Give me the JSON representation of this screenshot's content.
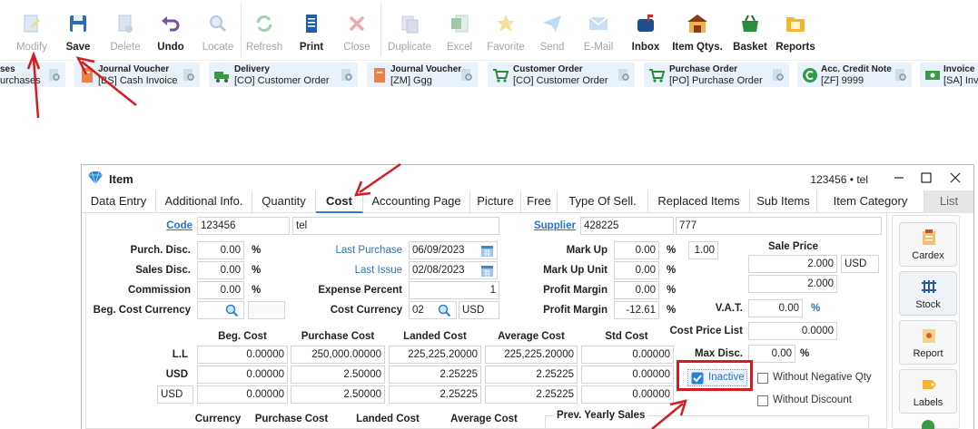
{
  "toolbar": {
    "buttons": [
      {
        "label": "Modify",
        "icon": "edit-doc-icon",
        "enabled": false
      },
      {
        "label": "Save",
        "icon": "floppy-disk-icon",
        "enabled": true
      },
      {
        "label": "Delete",
        "icon": "delete-doc-icon",
        "enabled": false
      },
      {
        "label": "Undo",
        "icon": "undo-arrow-icon",
        "enabled": true
      },
      {
        "label": "Locate",
        "icon": "magnifier-icon",
        "enabled": false
      },
      {
        "label": "Refresh",
        "icon": "refresh-icon",
        "enabled": false
      },
      {
        "label": "Print",
        "icon": "printer-icon",
        "enabled": true
      },
      {
        "label": "Close",
        "icon": "close-x-icon",
        "enabled": false
      },
      {
        "label": "Duplicate",
        "icon": "duplicate-icon",
        "enabled": false
      },
      {
        "label": "Excel",
        "icon": "excel-icon",
        "enabled": false
      },
      {
        "label": "Favorite",
        "icon": "star-icon",
        "enabled": false
      },
      {
        "label": "Send",
        "icon": "paper-plane-icon",
        "enabled": false
      },
      {
        "label": "E-Mail",
        "icon": "envelope-icon",
        "enabled": false
      },
      {
        "label": "Inbox",
        "icon": "mailbox-icon",
        "enabled": true
      },
      {
        "label": "Item Qtys.",
        "icon": "warehouse-icon",
        "enabled": true
      },
      {
        "label": "Basket",
        "icon": "basket-icon",
        "enabled": true
      },
      {
        "label": "Reports",
        "icon": "reports-folder-icon",
        "enabled": true
      }
    ]
  },
  "quickbar": {
    "items": [
      {
        "title": "ses",
        "subtitle": "urchases",
        "icon": "doc-icon"
      },
      {
        "title": "Journal Voucher",
        "subtitle": "[BS] Cash Invoice",
        "icon": "journal-icon"
      },
      {
        "title": "Delivery",
        "subtitle": "[CO] Customer Order",
        "icon": "truck-icon"
      },
      {
        "title": "Journal Voucher",
        "subtitle": "[ZM] Ggg",
        "icon": "journal-icon"
      },
      {
        "title": "Customer Order",
        "subtitle": "[CO] Customer Order",
        "icon": "cart-icon"
      },
      {
        "title": "Purchase Order",
        "subtitle": "[PO] Purchase Order",
        "icon": "cart-icon"
      },
      {
        "title": "Acc. Credit Note",
        "subtitle": "[ZF] 9999",
        "icon": "credit-note-icon"
      },
      {
        "title": "Invoice",
        "subtitle": "[SA] Invoice",
        "icon": "invoice-icon"
      }
    ]
  },
  "window": {
    "title": "Item",
    "meta": "123456 • tel",
    "tabs": [
      "Data Entry",
      "Additional Info.",
      "Quantity",
      "Cost",
      "Accounting Page",
      "Picture",
      "Free",
      "Type Of Sell.",
      "Replaced Items",
      "Sub Items",
      "Item Category",
      "List"
    ],
    "selected_tab": "Cost"
  },
  "form": {
    "code_label": "Code",
    "code_value": "123456",
    "name_value": "tel",
    "supplier_label": "Supplier",
    "supplier_code": "428225",
    "supplier_name": "777",
    "purch_disc_label": "Purch. Disc.",
    "purch_disc": "0.00",
    "sales_disc_label": "Sales Disc.",
    "sales_disc": "0.00",
    "commission_label": "Commission",
    "commission": "0.00",
    "beg_cost_currency_label": "Beg. Cost Currency",
    "percent": "%",
    "last_purchase_label": "Last Purchase",
    "last_purchase": "06/09/2023",
    "last_issue_label": "Last Issue",
    "last_issue": "02/08/2023",
    "expense_percent_label": "Expense Percent",
    "expense_percent": "1",
    "cost_currency_label": "Cost Currency",
    "cost_currency_code": "02",
    "cost_currency": "USD",
    "markup_label": "Mark Up",
    "markup": "0.00",
    "markup_factor": "1.00",
    "markup_unit_label": "Mark Up Unit",
    "markup_unit": "0.00",
    "profit_margin_label": "Profit Margin",
    "profit_margin_1": "0.00",
    "profit_margin_2": "-12.61",
    "sale_price_label": "Sale Price",
    "sale_price_1": "2.000",
    "sale_price_currency": "USD",
    "sale_price_2": "2.000",
    "vat_label": "V.A.T.",
    "vat": "0.00",
    "cost_price_list_label": "Cost Price List",
    "cost_price_list": "0.0000",
    "max_disc_label": "Max Disc.",
    "max_disc": "0.00",
    "inactive_label": "Inactive",
    "inactive_checked": true,
    "without_negative_qty_label": "Without Negative Qty",
    "without_discount_label": "Without Discount",
    "cost_table": {
      "headers": [
        "Beg. Cost",
        "Purchase Cost",
        "Landed Cost",
        "Average Cost",
        "Std Cost"
      ],
      "rows": [
        {
          "label": "L.L",
          "values": [
            "0.00000",
            "250,000.00000",
            "225,225.20000",
            "225,225.20000",
            "0.00000"
          ]
        },
        {
          "label": "USD",
          "values": [
            "0.00000",
            "2.50000",
            "2.25225",
            "2.25225",
            "0.00000"
          ]
        },
        {
          "label": "USD",
          "values": [
            "0.00000",
            "2.50000",
            "2.25225",
            "2.25225",
            "0.00000"
          ]
        }
      ]
    },
    "bottom_headers": [
      "Currency",
      "Purchase Cost",
      "Landed Cost",
      "Average Cost"
    ],
    "prev_yearly_sales_label": "Prev. Yearly Sales"
  },
  "side_buttons": [
    {
      "label": "Cardex",
      "icon": "cardex-icon"
    },
    {
      "label": "Stock",
      "icon": "stock-icon"
    },
    {
      "label": "Report",
      "icon": "report-icon"
    },
    {
      "label": "Labels",
      "icon": "labels-icon"
    }
  ]
}
